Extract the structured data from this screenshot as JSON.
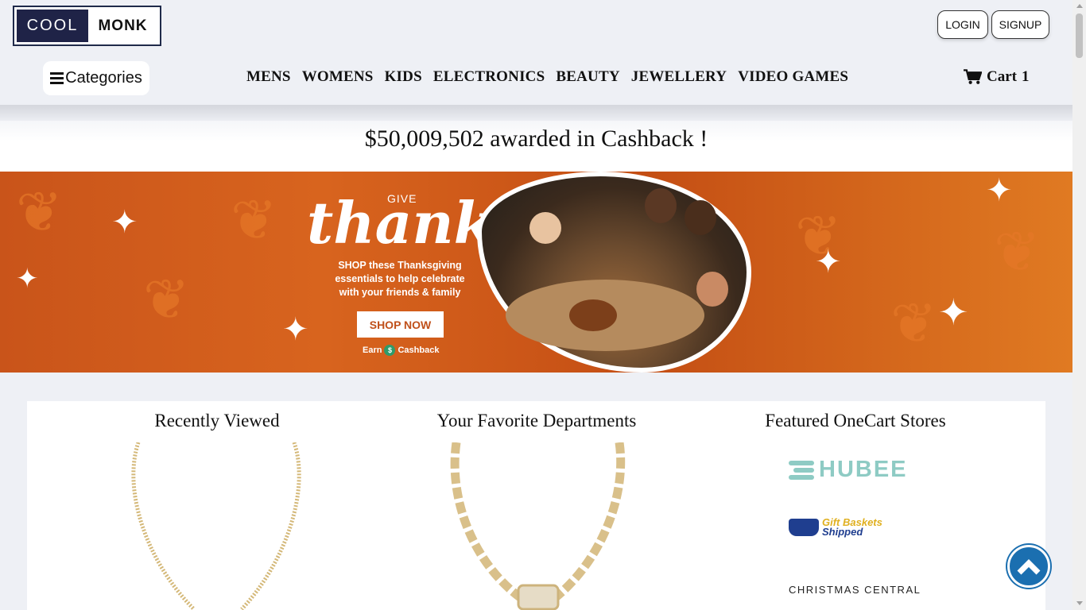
{
  "header": {
    "logo_left": "COOL",
    "logo_right": "MONK",
    "login_label": "LOGIN",
    "signup_label": "SIGNUP",
    "categories_label": "Categories",
    "nav": [
      "MENS",
      "WOMENS",
      "KIDS",
      "ELECTRONICS",
      "BEAUTY",
      "JEWELLERY",
      "VIDEO GAMES"
    ],
    "cart_label": "Cart",
    "cart_count": "1"
  },
  "cashback_text": "$50,009,502 awarded in Cashback !",
  "banner": {
    "give": "GIVE",
    "thanks": "thanks",
    "promo_text": "SHOP these Thanksgiving essentials to help celebrate with your friends & family",
    "shop_now": "SHOP NOW",
    "earn_prefix": "Earn",
    "earn_suffix": "Cashback",
    "dollar_symbol": "$"
  },
  "sections": {
    "recently_viewed": "Recently Viewed",
    "favorite_departments": "Your Favorite Departments",
    "featured_stores": "Featured OneCart Stores"
  },
  "stores": {
    "hubee": "HUBEE",
    "gift_line1": "Gift Baskets",
    "gift_line2": "Shipped",
    "christmas": "CHRISTMAS CENTRAL"
  },
  "colors": {
    "logo_dark": "#1f2347",
    "banner_orange": "#c9541a",
    "scroll_top_blue": "#1b6fb0",
    "hubee_teal": "#8ecbc4"
  },
  "icons": {
    "cart": "cart-icon",
    "menu": "hamburger-icon",
    "scroll_top": "chevron-up-icon"
  }
}
